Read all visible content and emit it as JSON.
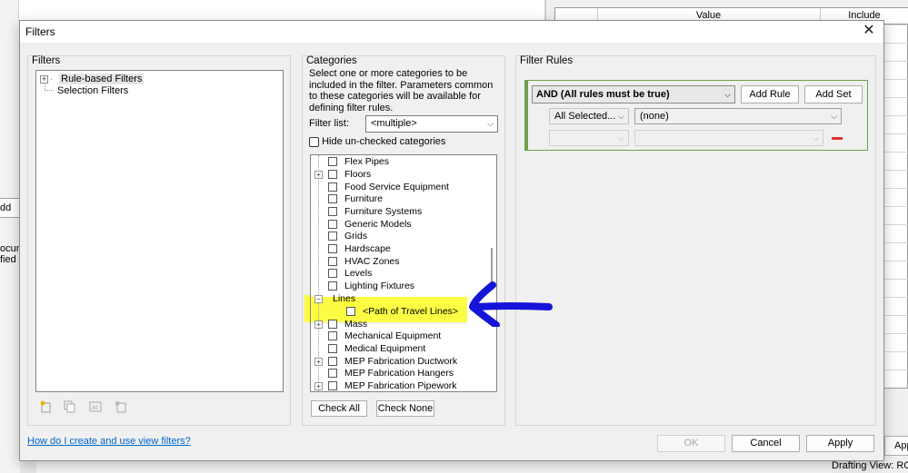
{
  "background": {
    "grid_headers": [
      "Value",
      "Include"
    ],
    "left_fragments": [
      "dd",
      "ocum",
      "fied I"
    ],
    "apply_fragment": "App",
    "status_text": "Drafting View: RC"
  },
  "dialog": {
    "title": "Filters",
    "close_symbol": "✕",
    "filters_panel": {
      "title": "Filters",
      "items": [
        {
          "label": "Rule-based Filters",
          "expander": "+",
          "selected": true
        },
        {
          "label": "Selection Filters"
        }
      ],
      "tool_icons": [
        "new-filter-icon",
        "duplicate-filter-icon",
        "rename-filter-icon",
        "delete-filter-icon"
      ]
    },
    "categories_panel": {
      "title": "Categories",
      "description": "Select one or more categories to be included in the filter.  Parameters common to these categories will be available for defining filter rules.",
      "filter_list_label": "Filter list:",
      "filter_list_value": "<multiple>",
      "hide_unchecked_label": "Hide un-checked categories",
      "rows": [
        {
          "label": "Flex Pipes",
          "expander": ""
        },
        {
          "label": "Floors",
          "expander": "+"
        },
        {
          "label": "Food Service Equipment",
          "expander": ""
        },
        {
          "label": "Furniture",
          "expander": ""
        },
        {
          "label": "Furniture Systems",
          "expander": ""
        },
        {
          "label": "Generic Models",
          "expander": ""
        },
        {
          "label": "Grids",
          "expander": ""
        },
        {
          "label": "Hardscape",
          "expander": ""
        },
        {
          "label": "HVAC Zones",
          "expander": ""
        },
        {
          "label": "Levels",
          "expander": ""
        },
        {
          "label": "Lighting Fixtures",
          "expander": ""
        },
        {
          "label": "Lines",
          "expander": "−"
        },
        {
          "label": "<Path of Travel Lines>",
          "expander": "",
          "child": true
        },
        {
          "label": "Mass",
          "expander": "+"
        },
        {
          "label": "Mechanical Equipment",
          "expander": ""
        },
        {
          "label": "Medical Equipment",
          "expander": ""
        },
        {
          "label": "MEP Fabrication Ductwork",
          "expander": "+"
        },
        {
          "label": "MEP Fabrication Hangers",
          "expander": ""
        },
        {
          "label": "MEP Fabrication Pipework",
          "expander": "+"
        }
      ],
      "check_all_label": "Check All",
      "check_none_label": "Check None"
    },
    "rules_panel": {
      "title": "Filter Rules",
      "logic_value": "AND (All rules must be true)",
      "add_rule_label": "Add Rule",
      "add_set_label": "Add Set",
      "rule1_param": "All Selected...",
      "rule1_value": "(none)",
      "rule2_param": "",
      "rule2_value": ""
    },
    "help_link": "How do I create and use view filters?",
    "ok_label": "OK",
    "cancel_label": "Cancel",
    "apply_label": "Apply"
  },
  "colors": {
    "highlight": "#fbfc43",
    "arrow": "#1515d8",
    "rules_border": "#6aa14a",
    "link": "#0066cc"
  }
}
